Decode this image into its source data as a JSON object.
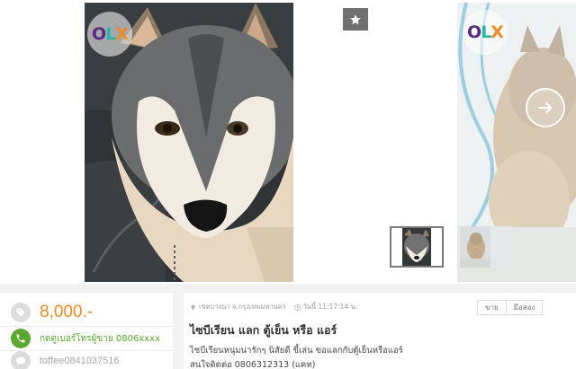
{
  "gallery": {
    "main_photo_alt": "",
    "badge": {
      "o": "O",
      "l": "L",
      "x": "X"
    },
    "favorite_icon": "star-icon",
    "next_icon": "arrow-right-icon",
    "thumbnails": [
      "thumb-1",
      "thumb-2"
    ]
  },
  "listing": {
    "price": "8,000.-",
    "phone_cta": "กดดูเบอร์โทรผู้ขาย 0806xxxx",
    "line_id": "toffee0841037516",
    "location": "เขตบางนา จ.กรุงเทพมหานคร",
    "posted": "วันนี้ 11:17:14 น.",
    "tags": [
      "ขาย",
      "มือสอง"
    ],
    "title": "ไซบีเรียน แลก ตู้เย็น หรือ แอร์",
    "description_lines": [
      "ไซบีเรียนหนุ่มน่ารักๆ นิสัยดี ขี้เล่น ขอแลกกับตู้เย็นหรือแอร์",
      "สนใจติดต่อ 0806312313 (แคท)"
    ]
  },
  "colors": {
    "price": "#f08a24",
    "phone": "#5aa82e",
    "olx_purple": "#5b2a86",
    "olx_teal": "#28b7a9",
    "olx_orange": "#f08a24"
  }
}
